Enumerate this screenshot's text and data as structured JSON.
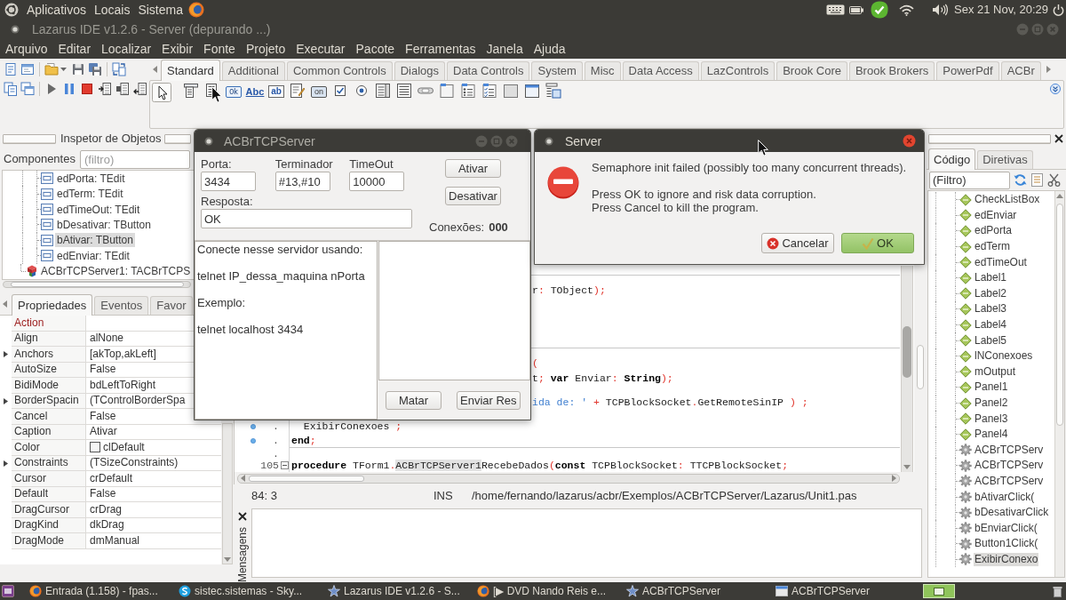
{
  "top_panel": {
    "menus": [
      "Aplicativos",
      "Locais",
      "Sistema"
    ],
    "clock": "Sex 21 Nov, 20:29"
  },
  "window": {
    "title": "Lazarus IDE v1.2.6 - Server (depurando ...)"
  },
  "menu_bar": [
    "Arquivo",
    "Editar",
    "Localizar",
    "Exibir",
    "Fonte",
    "Projeto",
    "Executar",
    "Pacote",
    "Ferramentas",
    "Janela",
    "Ajuda"
  ],
  "palette": {
    "tabs": [
      {
        "label": "Standard",
        "selected": true
      },
      {
        "label": "Additional",
        "selected": false
      },
      {
        "label": "Common Controls",
        "selected": false
      },
      {
        "label": "Dialogs",
        "selected": false
      },
      {
        "label": "Data Controls",
        "selected": false
      },
      {
        "label": "System",
        "selected": false
      },
      {
        "label": "Misc",
        "selected": false
      },
      {
        "label": "Data Access",
        "selected": false
      },
      {
        "label": "LazControls",
        "selected": false
      },
      {
        "label": "Brook Core",
        "selected": false
      },
      {
        "label": "Brook Brokers",
        "selected": false
      },
      {
        "label": "PowerPdf",
        "selected": false
      },
      {
        "label": "ACBr",
        "selected": false
      }
    ],
    "components": [
      {
        "kind": "pointer",
        "selected": true
      },
      {
        "kind": "main-menu",
        "selected": false
      },
      {
        "kind": "popup-menu",
        "selected": false
      },
      {
        "kind": "button",
        "text": "0k",
        "selected": false
      },
      {
        "kind": "label",
        "text": "Abc",
        "selected": false
      },
      {
        "kind": "edit",
        "text": "ab",
        "selected": false
      },
      {
        "kind": "memo",
        "selected": false
      },
      {
        "kind": "toggle",
        "text": "on",
        "selected": false
      },
      {
        "kind": "checkbox",
        "selected": false
      },
      {
        "kind": "radio",
        "selected": false
      },
      {
        "kind": "listbox",
        "selected": false
      },
      {
        "kind": "combobox",
        "selected": false
      },
      {
        "kind": "scrollbar",
        "selected": false
      },
      {
        "kind": "groupbox",
        "selected": false
      },
      {
        "kind": "radiogroup",
        "selected": false
      },
      {
        "kind": "checkgroup",
        "selected": false
      },
      {
        "kind": "panel",
        "selected": false
      },
      {
        "kind": "frame",
        "selected": false
      },
      {
        "kind": "actionlist",
        "selected": false
      }
    ]
  },
  "object_inspector": {
    "title": "Inspetor de Objetos",
    "filter_label": "Componentes",
    "filter_placeholder": "(filtro)",
    "tree": [
      {
        "children": [
          {
            "label": "edPorta: TEdit",
            "kind": "control",
            "selected": false
          },
          {
            "label": "edTerm: TEdit",
            "kind": "control",
            "selected": false
          },
          {
            "label": "edTimeOut: TEdit",
            "kind": "control",
            "selected": false
          },
          {
            "label": "bDesativar: TButton",
            "kind": "control",
            "selected": false
          },
          {
            "label": "bAtivar: TButton",
            "kind": "control",
            "selected": true
          },
          {
            "label": "edEnviar: TEdit",
            "kind": "control",
            "selected": false
          }
        ]
      },
      {
        "label": "ACBrTCPServer1: TACBrTCPS",
        "kind": "component",
        "selected": false
      }
    ],
    "tabs": [
      {
        "label": "Propriedades",
        "selected": true
      },
      {
        "label": "Eventos",
        "selected": false
      },
      {
        "label": "Favor",
        "selected": false
      }
    ],
    "properties": [
      {
        "name": "Action",
        "kind": "reference",
        "expandable": false
      },
      {
        "name": "Align",
        "value": "alNone",
        "kind": "plain",
        "expandable": false
      },
      {
        "name": "Anchors",
        "value": "[akTop,akLeft]",
        "kind": "plain",
        "expandable": true
      },
      {
        "name": "AutoSize",
        "value": "False",
        "kind": "plain",
        "expandable": false
      },
      {
        "name": "BidiMode",
        "value": "bdLeftToRight",
        "kind": "plain",
        "expandable": false
      },
      {
        "name": "BorderSpacin",
        "value": "(TControlBorderSpa",
        "kind": "plain",
        "expandable": true
      },
      {
        "name": "Cancel",
        "value": "False",
        "kind": "plain",
        "expandable": false
      },
      {
        "name": "Caption",
        "value": "Ativar",
        "kind": "plain",
        "expandable": false
      },
      {
        "name": "Color",
        "value": "clDefault",
        "kind": "color",
        "expandable": false
      },
      {
        "name": "Constraints",
        "value": "(TSizeConstraints)",
        "kind": "plain",
        "expandable": true
      },
      {
        "name": "Cursor",
        "value": "crDefault",
        "kind": "plain",
        "expandable": false
      },
      {
        "name": "Default",
        "value": "False",
        "kind": "plain",
        "expandable": false
      },
      {
        "name": "DragCursor",
        "value": "crDrag",
        "kind": "plain",
        "expandable": false
      },
      {
        "name": "DragKind",
        "value": "dkDrag",
        "kind": "plain",
        "expandable": false
      },
      {
        "name": "DragMode",
        "value": "dmManual",
        "kind": "plain",
        "expandable": false
      }
    ]
  },
  "editor": {
    "lines": [
      {
        "kind": "partial",
        "tokens": [
          {
            "text": "r",
            "kind": "plain"
          },
          {
            "text": ":",
            "kind": "symbol"
          },
          {
            "text": " TObject",
            "kind": "plain"
          },
          {
            "text": ");",
            "kind": "symbol"
          }
        ]
      },
      {
        "kind": "partial",
        "tokens": [
          {
            "text": "(",
            "kind": "symbol"
          }
        ]
      },
      {
        "kind": "partial",
        "tokens": [
          {
            "text": "t",
            "kind": "plain"
          },
          {
            "text": ";",
            "kind": "symbol"
          },
          {
            "text": " var",
            "kind": "keyword"
          },
          {
            "text": " Enviar",
            "kind": "plain"
          },
          {
            "text": ":",
            "kind": "symbol"
          },
          {
            "text": " String",
            "kind": "keyword"
          },
          {
            "text": ");",
            "kind": "symbol"
          }
        ]
      },
      {
        "kind": "partial",
        "tokens": [
          {
            "text": "ida de: '",
            "kind": "string"
          },
          {
            "text": " + ",
            "kind": "symbol"
          },
          {
            "text": "TCPBlockSocket",
            "kind": "plain"
          },
          {
            "text": ".",
            "kind": "symbol"
          },
          {
            "text": "GetRemoteSinIP",
            "kind": "plain"
          },
          {
            "text": " ) ;",
            "kind": "symbol"
          }
        ]
      },
      {
        "kind": "full",
        "gutter": ".",
        "executable": true,
        "fold": false,
        "tokens": [
          {
            "text": "  ExibirConexoes",
            "kind": "plain"
          },
          {
            "text": " ;",
            "kind": "symbol"
          }
        ]
      },
      {
        "kind": "full",
        "gutter": ".",
        "executable": true,
        "fold": false,
        "tokens": [
          {
            "text": "end",
            "kind": "keyword"
          },
          {
            "text": ";",
            "kind": "symbol"
          }
        ]
      },
      {
        "kind": "full",
        "gutter": ".",
        "executable": false,
        "fold": false
      },
      {
        "kind": "full",
        "gutter": "105",
        "executable": false,
        "fold": true,
        "tokens": [
          {
            "text": "procedure",
            "kind": "keyword"
          },
          {
            "text": " TForm1",
            "kind": "plain"
          },
          {
            "text": ".",
            "kind": "symbol"
          },
          {
            "text": "ACBrTCPServer1",
            "kind": "highlight"
          },
          {
            "text": "RecebeDados",
            "kind": "plain"
          },
          {
            "text": "(",
            "kind": "symbol"
          },
          {
            "text": "const",
            "kind": "keyword"
          },
          {
            "text": " TCPBlockSocket",
            "kind": "plain"
          },
          {
            "text": ":",
            "kind": "symbol"
          },
          {
            "text": " TTCPBlockSocket",
            "kind": "plain"
          },
          {
            "text": ";",
            "kind": "symbol"
          }
        ]
      }
    ]
  },
  "status_bar": {
    "position": "84: 3",
    "mode": "INS",
    "file": "/home/fernando/lazarus/acbr/Exemplos/ACBrTCPServer/Lazarus/Unit1.pas"
  },
  "messages": {
    "title": "Mensagens"
  },
  "code_explorer": {
    "tabs": [
      {
        "label": "Código",
        "selected": true
      },
      {
        "label": "Diretivas",
        "selected": false
      }
    ],
    "filter": "(Filtro)",
    "items": [
      {
        "label": "CheckListBox",
        "kind": "control",
        "selected": false
      },
      {
        "label": "edEnviar",
        "kind": "control",
        "selected": false
      },
      {
        "label": "edPorta",
        "kind": "control",
        "selected": false
      },
      {
        "label": "edTerm",
        "kind": "control",
        "selected": false
      },
      {
        "label": "edTimeOut",
        "kind": "control",
        "selected": false
      },
      {
        "label": "Label1",
        "kind": "control",
        "selected": false
      },
      {
        "label": "Label2",
        "kind": "control",
        "selected": false
      },
      {
        "label": "Label3",
        "kind": "control",
        "selected": false
      },
      {
        "label": "Label4",
        "kind": "control",
        "selected": false
      },
      {
        "label": "Label5",
        "kind": "control",
        "selected": false
      },
      {
        "label": "lNConexoes",
        "kind": "control",
        "selected": false
      },
      {
        "label": "mOutput",
        "kind": "control",
        "selected": false
      },
      {
        "label": "Panel1",
        "kind": "control",
        "selected": false
      },
      {
        "label": "Panel2",
        "kind": "control",
        "selected": false
      },
      {
        "label": "Panel3",
        "kind": "control",
        "selected": false
      },
      {
        "label": "Panel4",
        "kind": "control",
        "selected": false
      },
      {
        "label": "ACBrTCPServ",
        "kind": "method",
        "selected": false
      },
      {
        "label": "ACBrTCPServ",
        "kind": "method",
        "selected": false
      },
      {
        "label": "ACBrTCPServ",
        "kind": "method",
        "selected": false
      },
      {
        "label": "bAtivarClick(",
        "kind": "method",
        "selected": false
      },
      {
        "label": "bDesativarClick",
        "kind": "method",
        "selected": false
      },
      {
        "label": "bEnviarClick(",
        "kind": "method",
        "selected": false
      },
      {
        "label": "Button1Click(",
        "kind": "method",
        "selected": false
      },
      {
        "label": "ExibirConexo",
        "kind": "method",
        "selected": true
      }
    ]
  },
  "tcp_server_dialog": {
    "title": "ACBrTCPServer",
    "fields": [
      {
        "label": "Porta:",
        "value": "3434"
      },
      {
        "label": "Terminador",
        "value": "#13,#10"
      },
      {
        "label": "TimeOut",
        "value": "10000"
      }
    ],
    "actions": [
      "Ativar",
      "Desativar"
    ],
    "response": {
      "label": "Resposta:",
      "value": "OK"
    },
    "connections": {
      "label": "Conexões:",
      "value": "000"
    },
    "info": [
      "Conecte nesse servidor usando:",
      "telnet IP_dessa_maquina nPorta",
      "Exemplo:",
      "telnet localhost 3434"
    ],
    "buttons": [
      "Matar",
      "Enviar Res"
    ]
  },
  "error_dialog": {
    "title": "Server",
    "paragraphs": [
      "Semaphore init failed (possibly too many concurrent threads).",
      "Press OK to ignore and risk data corruption.\nPress Cancel to kill the program."
    ],
    "buttons": [
      {
        "label": "Cancelar",
        "kind": "cancel",
        "default": false
      },
      {
        "label": "OK",
        "kind": "ok",
        "default": true
      }
    ]
  },
  "taskbar": {
    "items": [
      {
        "label": "Entrada (1.158) - fpas...",
        "kind": "browser"
      },
      {
        "label": "sistec.sistemas - Sky...",
        "kind": "messenger"
      },
      {
        "label": "Lazarus IDE v1.2.6 - S...",
        "kind": "ide"
      },
      {
        "label": "[▶ DVD Nando Reis e...",
        "kind": "browser"
      },
      {
        "label": "ACBrTCPServer",
        "kind": "ide"
      },
      {
        "label": "ACBrTCPServer",
        "kind": "window"
      }
    ]
  }
}
